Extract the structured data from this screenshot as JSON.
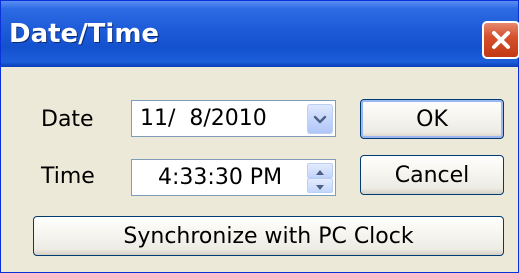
{
  "window": {
    "title": "Date/Time"
  },
  "form": {
    "date_label": "Date",
    "date_value": "11/  8/2010",
    "time_label": "Time",
    "time_value": "4:33:30 PM"
  },
  "buttons": {
    "ok": "OK",
    "cancel": "Cancel",
    "sync": "Synchronize with PC Clock"
  },
  "icons": {
    "close": "close-icon",
    "dropdown": "chevron-down-icon",
    "spin_up": "spin-up-icon",
    "spin_down": "spin-down-icon"
  },
  "colors": {
    "titlebar": "#1c5ad8",
    "face": "#ece9d8",
    "close": "#d6512c"
  }
}
